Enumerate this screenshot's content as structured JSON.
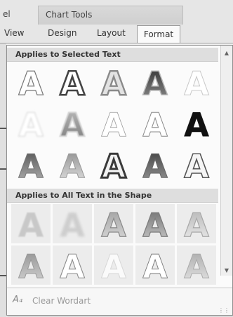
{
  "ribbon": {
    "left_fragment": "el",
    "context_group_title": "Chart Tools",
    "tabs": [
      {
        "label": "View"
      },
      {
        "label": "Design"
      },
      {
        "label": "Layout"
      },
      {
        "label": "Format",
        "active": true
      }
    ]
  },
  "gallery": {
    "sections": [
      {
        "title": "Applies to Selected Text"
      },
      {
        "title": "Applies to All Text in the Shape"
      }
    ],
    "glyph": "A",
    "styles_selected_text": [
      [
        "outline-plain",
        "outline-bold",
        "outline-gray",
        "gradient-dark",
        "outline-light"
      ],
      [
        "glow-light",
        "glow-gray",
        "outline-thin",
        "outline-white",
        "solid-black"
      ],
      [
        "gradient-gray",
        "gradient-light",
        "double-outline",
        "gradient-dark-2",
        "outline-dark"
      ]
    ],
    "styles_all_text": [
      [
        "shadow-gray",
        "blur-gray",
        "gradient-3d",
        "gradient-3d-dark",
        "gradient-3d-light"
      ],
      [
        "gradient-gray-2",
        "outline-plain-2",
        "faded-outline",
        "outline-thin-2",
        "gradient-light-2"
      ]
    ],
    "footer": {
      "clear_label": "Clear Wordart",
      "clear_icon": "clear-formatting-icon"
    },
    "colors": {
      "header_bg": "#dedede",
      "panel_bg": "#fbfbfb",
      "border": "#8f8f8f"
    }
  }
}
